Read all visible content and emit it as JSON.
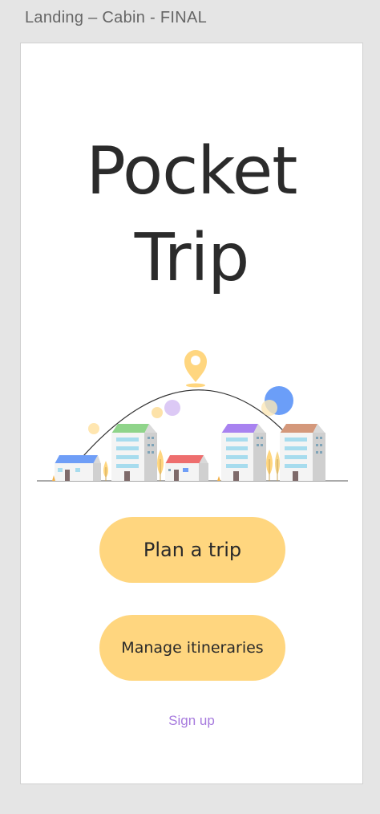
{
  "frame": {
    "label": "Landing – Cabin - FINAL"
  },
  "app": {
    "title_line1": "Pocket",
    "title_line2": "Trip"
  },
  "actions": {
    "plan_label": "Plan a trip",
    "manage_label": "Manage itineraries",
    "signup_label": "Sign up"
  },
  "illustration": {
    "pin_icon": "location-pin-icon"
  },
  "colors": {
    "accent": "#ffd67f",
    "title": "#2b2b2b",
    "link": "#a77bde",
    "roof_blue": "#6f9ef7",
    "roof_green": "#8fd48a",
    "roof_red": "#ee6e6e",
    "roof_purple": "#a882f0",
    "roof_tan": "#d4987b"
  }
}
